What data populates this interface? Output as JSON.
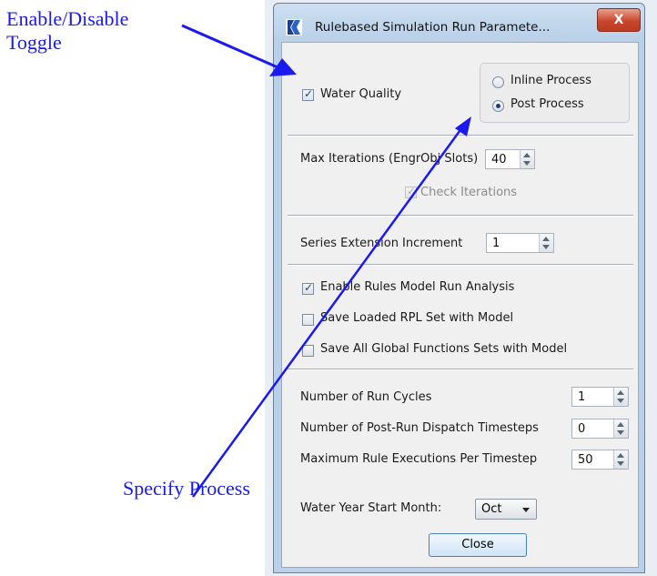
{
  "annotations": {
    "toggle": "Enable/Disable Toggle",
    "process": "Specify Process"
  },
  "window": {
    "title": "Rulebased Simulation Run Paramete...",
    "close_glyph": "X"
  },
  "water_quality": {
    "label": "Water Quality",
    "checked": true
  },
  "process_options": [
    {
      "label": "Inline Process",
      "selected": false
    },
    {
      "label": "Post Process",
      "selected": true
    }
  ],
  "max_iterations": {
    "label": "Max Iterations  (EngrObj Slots)",
    "value": "40"
  },
  "check_iterations": {
    "label": "Check Iterations",
    "checked": true,
    "enabled": false
  },
  "series_extension": {
    "label": "Series Extension Increment",
    "value": "1"
  },
  "options": [
    {
      "label": "Enable Rules Model Run Analysis",
      "checked": true
    },
    {
      "label": "Save Loaded RPL Set with Model",
      "checked": false
    },
    {
      "label": "Save All Global Functions Sets with Model",
      "checked": false
    }
  ],
  "run_cycles": {
    "label": "Number of Run Cycles",
    "value": "1"
  },
  "post_run_dispatch": {
    "label": "Number of Post-Run Dispatch Timesteps",
    "value": "0"
  },
  "max_rule_executions": {
    "label": "Maximum Rule Executions Per Timestep",
    "value": "50"
  },
  "water_year": {
    "label": "Water Year Start Month:",
    "value": "Oct"
  },
  "close_button": {
    "label": "Close"
  },
  "colors": {
    "annotation": "#1a1af0",
    "titlebar": "#b9d0e8",
    "close_red": "#c9462c"
  }
}
